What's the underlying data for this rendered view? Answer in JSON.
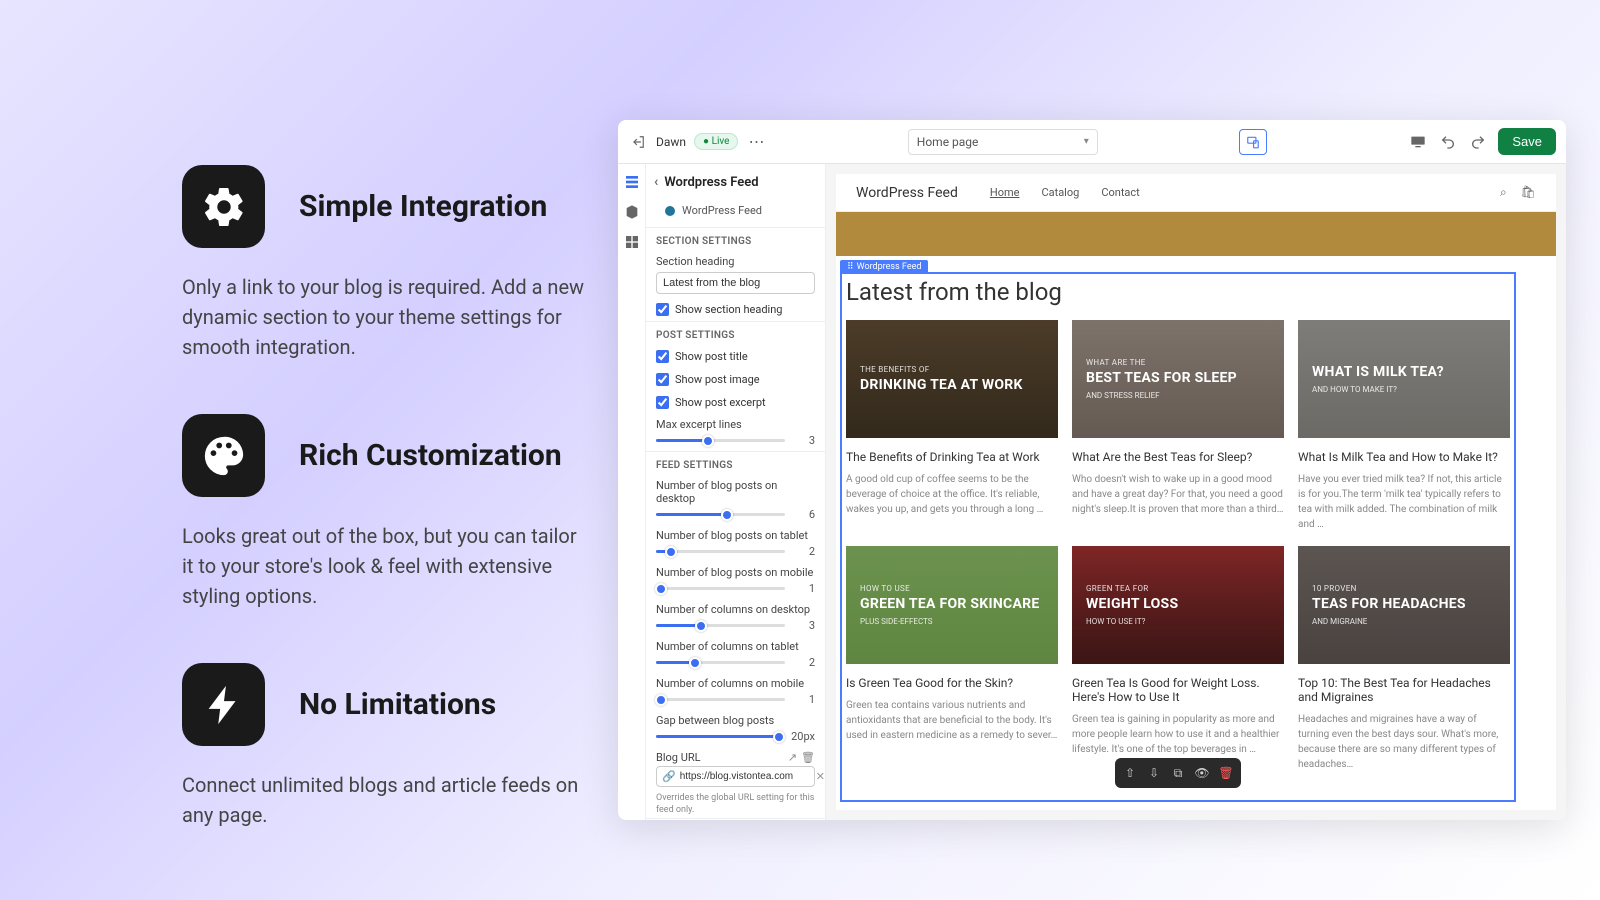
{
  "features": [
    {
      "title": "Simple Integration",
      "desc": "Only a link to your blog is required. Add a new dynamic section to your theme settings for smooth integration."
    },
    {
      "title": "Rich Customization",
      "desc": "Looks great out of the box, but you can tailor it to your store's look & feel with extensive styling options."
    },
    {
      "title": "No Limitations",
      "desc": "Connect unlimited blogs and article feeds on any page."
    }
  ],
  "topbar": {
    "theme_name": "Dawn",
    "status": "Live",
    "page_selector": "Home page",
    "save_label": "Save"
  },
  "sidebar": {
    "title": "Wordpress Feed",
    "block_label": "WordPress Feed",
    "section_settings_label": "SECTION SETTINGS",
    "heading_label": "Section heading",
    "heading_value": "Latest from the blog",
    "show_heading_label": "Show section heading",
    "post_settings_label": "POST SETTINGS",
    "show_title_label": "Show post title",
    "show_image_label": "Show post image",
    "show_excerpt_label": "Show post excerpt",
    "max_excerpt_label": "Max excerpt lines",
    "feed_settings_label": "FEED SETTINGS",
    "sliders": [
      {
        "label": "Max excerpt lines",
        "value": "3",
        "pct": 40
      },
      {
        "label": "Number of blog posts on desktop",
        "value": "6",
        "pct": 55
      },
      {
        "label": "Number of blog posts on tablet",
        "value": "2",
        "pct": 12
      },
      {
        "label": "Number of blog posts on mobile",
        "value": "1",
        "pct": 4
      },
      {
        "label": "Number of columns on desktop",
        "value": "3",
        "pct": 35
      },
      {
        "label": "Number of columns on tablet",
        "value": "2",
        "pct": 30
      },
      {
        "label": "Number of columns on mobile",
        "value": "1",
        "pct": 4
      },
      {
        "label": "Gap between blog posts",
        "value": "20px",
        "pct": 95
      }
    ],
    "blog_url_label": "Blog URL",
    "blog_url_value": "https://blog.vistontea.com",
    "blog_url_helper": "Overrides the global URL setting for this feed only.",
    "remove_label": "Remove block"
  },
  "preview": {
    "brand": "WordPress Feed",
    "nav": [
      "Home",
      "Catalog",
      "Contact"
    ],
    "tag_label": "Wordpress Feed",
    "section_title": "Latest from the blog",
    "cards": [
      {
        "bg": "linear-gradient(rgba(0,0,0,0.45),rgba(0,0,0,0.45)),linear-gradient(#8a6d4a,#5c4a32)",
        "ov_small": "THE BENEFITS OF",
        "ov_big": "DRINKING TEA AT WORK",
        "ov_sub": "",
        "title": "The Benefits of Drinking Tea at Work",
        "desc": "A good old cup of coffee seems to be the beverage of choice at the office. It's reliable, wakes you up, and gets you through a long …"
      },
      {
        "bg": "linear-gradient(rgba(30,30,50,0.45),rgba(30,30,50,0.45)),linear-gradient(#c9b89a,#a08c6e)",
        "ov_small": "WHAT ARE THE",
        "ov_big": "BEST TEAS FOR SLEEP",
        "ov_sub": "AND STRESS RELIEF",
        "title": "What Are the Best Teas for Sleep?",
        "desc": "Who doesn't wish to wake up in a good mood and have a great day? For that, you need a good night's sleep.It is proven that more than a third…"
      },
      {
        "bg": "linear-gradient(rgba(40,50,60,0.5),rgba(40,50,60,0.5)),linear-gradient(#d4c8b8,#b0a28e)",
        "ov_small": "",
        "ov_big": "WHAT IS MILK TEA?",
        "ov_sub": "AND HOW TO MAKE IT?",
        "title": "What Is Milk Tea and How to Make It?",
        "desc": "Have you ever tried milk tea? If not, this article is for you.The term 'milk tea' typically refers to tea with milk added. The combination of milk and …"
      },
      {
        "bg": "linear-gradient(rgba(70,120,40,0.7),rgba(70,120,40,0.7)),linear-gradient(#c4cfa8,#9aa87a)",
        "ov_small": "HOW TO USE",
        "ov_big": "GREEN TEA FOR SKINCARE",
        "ov_sub": "PLUS SIDE-EFFECTS",
        "title": "Is Green Tea Good for the Skin?",
        "desc": "Green tea contains various nutrients and antioxidants that are beneficial to the body. It's used in eastern medicine as a remedy to sever…"
      },
      {
        "bg": "linear-gradient(rgba(120,30,30,0.55),rgba(60,20,20,0.7)),linear-gradient(#8a3030,#3a1818)",
        "ov_small": "GREEN TEA FOR",
        "ov_big": "WEIGHT LOSS",
        "ov_sub": "HOW TO USE IT?",
        "title": "Green Tea Is Good for Weight Loss. Here's How to Use It",
        "desc": "Green tea is gaining in popularity as more and more people learn how to use it and a healthier lifestyle. It's one of the top beverages in …"
      },
      {
        "bg": "linear-gradient(rgba(30,40,55,0.6),rgba(30,40,55,0.6)),linear-gradient(#b89878,#8a6a4c)",
        "ov_small": "10 PROVEN",
        "ov_big": "TEAS FOR HEADACHES",
        "ov_sub": "AND MIGRAINE",
        "title": "Top 10: The Best Tea for Headaches and Migraines",
        "desc": "Headaches and migraines have a way of turning even the best days sour. What's more, because there are so many different types of headaches…"
      }
    ]
  }
}
